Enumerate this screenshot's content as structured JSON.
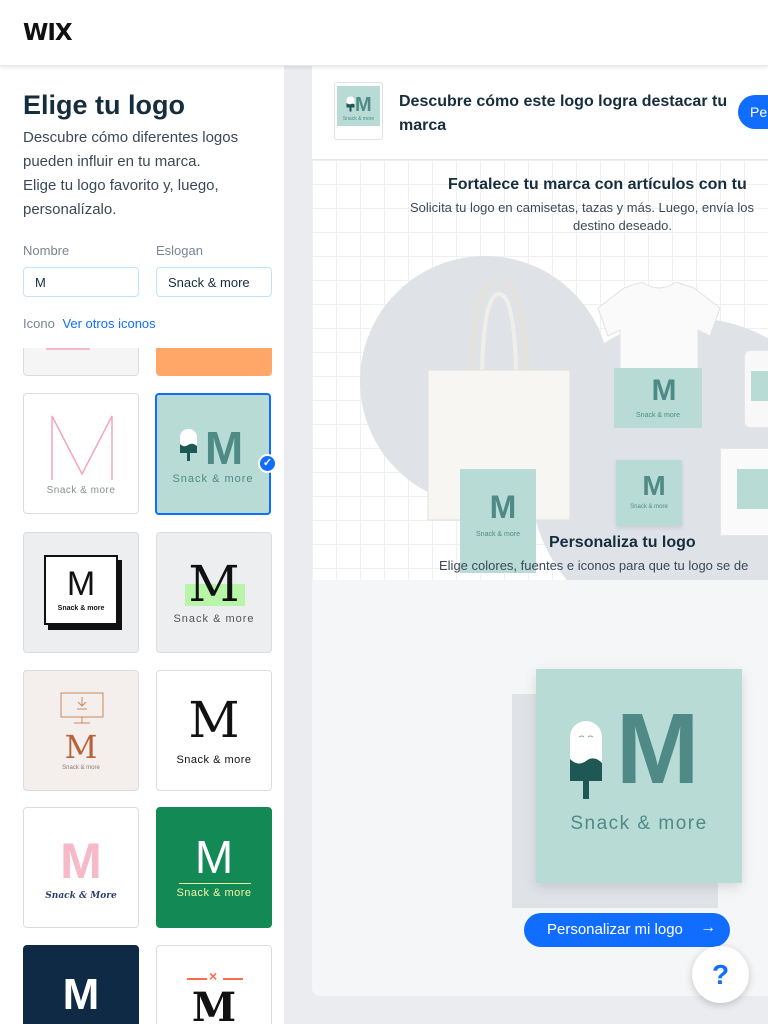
{
  "header": {
    "brand": "WIX"
  },
  "sidebar": {
    "title": "Elige tu logo",
    "description_lines": [
      "Descubre cómo diferentes logos pueden influir en tu marca.",
      "Elige tu logo favorito y, luego, personalízalo."
    ],
    "name_label": "Nombre",
    "name_value": "M",
    "slogan_label": "Eslogan",
    "slogan_value": "Snack & more",
    "icon_label": "Icono",
    "icon_link": "Ver otros iconos",
    "tiles": [
      {
        "letter": "M",
        "slogan": "Snack & more"
      },
      {
        "letter": "M",
        "slogan": "Snack & more",
        "selected": true
      },
      {
        "letter": "M",
        "slogan": "Snack & more"
      },
      {
        "letter": "M",
        "slogan": "Snack & more"
      },
      {
        "letter": "M",
        "slogan": "Snack & more"
      },
      {
        "letter": "M",
        "slogan": "Snack & more"
      },
      {
        "letter": "M",
        "slogan": "Snack & More"
      },
      {
        "letter": "M",
        "slogan": "Snack & more"
      },
      {
        "letter": "M"
      },
      {
        "letter": "M"
      }
    ]
  },
  "banner": {
    "text": "Descubre cómo este logo logra destacar tu marca",
    "button": "Pe"
  },
  "promo": {
    "title": "Fortalece tu marca con artículos con tu",
    "desc_line1": "Solicita tu logo en camisetas, tazas y más. Luego, envía los",
    "desc_line2": "destino deseado.",
    "logo_letter": "M",
    "logo_slogan": "Snack & more"
  },
  "customize": {
    "title": "Personaliza tu logo",
    "description": "Elige colores, fuentes e iconos para que tu logo se de",
    "logo_letter": "M",
    "logo_slogan": "Snack & more",
    "cta": "Personalizar mi logo",
    "cta_arrow": "→"
  },
  "help": {
    "label": "?"
  },
  "colors": {
    "accent": "#116dff",
    "mint": "#b8dcd5",
    "teal": "#4f8a87",
    "green": "#138a55",
    "navy": "#0f2a44",
    "orange": "#ffa768",
    "pink": "#f7b8c8"
  }
}
